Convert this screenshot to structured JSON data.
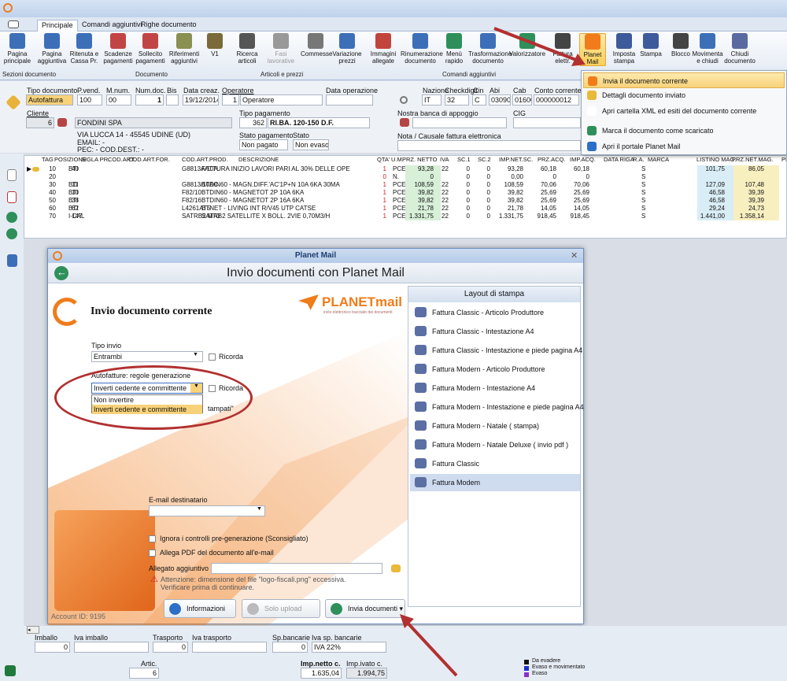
{
  "ribbon": {
    "tabs": [
      "Principale",
      "Comandi aggiuntivi",
      "Righe documento"
    ],
    "buttons": [
      {
        "name": "pagina-principale",
        "label": "Pagina\nprincipale"
      },
      {
        "name": "pagina-aggiuntiva",
        "label": "Pagina\naggiuntiva"
      },
      {
        "name": "ritenuta-cassa",
        "label": "Ritenuta e\nCassa Pr."
      },
      {
        "name": "scadenze-pagamenti",
        "label": "Scadenze\npagamenti"
      },
      {
        "name": "sollecito-pagamenti",
        "label": "Sollecito\npagamenti"
      },
      {
        "name": "riferimenti-aggiuntivi",
        "label": "Riferimenti\naggiuntivi"
      },
      {
        "name": "v1",
        "label": "V1"
      },
      {
        "name": "ricerca-articoli",
        "label": "Ricerca\narticoli"
      },
      {
        "name": "fasi-lavorative",
        "label": "Fasi\nlavorative"
      },
      {
        "name": "commesse",
        "label": "Commesse"
      },
      {
        "name": "variazione-prezzi",
        "label": "Variazione\nprezzi"
      },
      {
        "name": "immagini-allegate",
        "label": "Immagini\nallegate"
      },
      {
        "name": "rinumerazione-documento",
        "label": "Rinumerazione\ndocumento"
      },
      {
        "name": "menu-rapido",
        "label": "Menù\nrapido"
      },
      {
        "name": "trasformazione-documento",
        "label": "Trasformazione\ndocumento"
      },
      {
        "name": "valorizzatore",
        "label": "Valorizzatore"
      },
      {
        "name": "fattura-elettr",
        "label": "Fattura\nelettr."
      },
      {
        "name": "planet-mail",
        "label": "Planet\nMail"
      },
      {
        "name": "imposta-stampa",
        "label": "Imposta\nstampa"
      },
      {
        "name": "stampa",
        "label": "Stampa"
      },
      {
        "name": "blocco",
        "label": "Blocco"
      },
      {
        "name": "movimenta-chiudi",
        "label": "Movimenta\ne chiudi"
      },
      {
        "name": "chiudi-documento",
        "label": "Chiudi\ndocumento"
      }
    ],
    "groups": [
      "Sezioni documento",
      "Documento",
      "Articoli e prezzi",
      "Comandi aggiuntivi"
    ]
  },
  "form": {
    "tipo_documento_label": "Tipo documento",
    "tipo_documento": "Autofattura",
    "p_vend_label": "P.vend.",
    "p_vend": "100",
    "m_num_label": "M.num.",
    "m_num": "00",
    "num_doc_label": "Num.doc.",
    "num_doc": "1",
    "bis_label": "Bis",
    "data_creaz_label": "Data creaz.",
    "data_creaz": "19/12/2014",
    "operatore_label": "Operatore",
    "operatore_num": "1",
    "operatore": "Operatore",
    "data_operazione_label": "Data operazione",
    "cliente_label": "Cliente",
    "cliente_num": "6",
    "cliente": "FONDINI SPA",
    "indirizzo": "VIA LUCCA 14 - 45545 UDINE (UD)",
    "email": "EMAIL: -",
    "pec": "PEC: - COD.DEST.: -",
    "tipo_pagamento_label": "Tipo pagamento",
    "tipo_pagamento_num": "362",
    "tipo_pagamento": "RI.BA. 120-150 D.F.",
    "stato_pagamento_label": "Stato pagamento",
    "stato_pagamento": "Non pagato",
    "stato_label": "Stato",
    "stato": "Non evaso",
    "nazione_label": "Nazione",
    "nazione": "IT",
    "checkdigit_label": "Checkdigit",
    "checkdigit": "32",
    "cin_label": "Cin",
    "cin": "C",
    "abi_label": "Abi",
    "abi": "03090",
    "cab_label": "Cab",
    "cab": "01600",
    "conto_label": "Conto corrente",
    "conto": "000000012",
    "banca_label": "Nostra banca di appoggio",
    "cig_label": "CIG",
    "nota_label": "Nota / Causale fattura elettronica"
  },
  "grid": {
    "headers": [
      "TAG",
      "POSIZIONE",
      "SIGLA PR.",
      "COD.ART.",
      "COD.ART.FOR.",
      "COD.ART.PROD.",
      "DESCRIZIONE",
      "QTA'",
      "U.M.",
      "PRZ. NETTO",
      "IVA",
      "SC.1",
      "SC.2",
      "IMP.NET.SC.",
      "PRZ.ACQ.",
      "IMP.ACQ.",
      "DATA RIGA",
      "R.A.",
      "MARCA",
      "LISTINO MAG.",
      "PRZ.NET.MAG.",
      "PRZ"
    ],
    "rows": [
      [
        "10",
        "BTI",
        "40",
        "",
        "G8813A/10A",
        "FATTURA INIZIO LAVORI PARI AL 30% DELLE OPE",
        "1",
        "PCE",
        "93,28",
        "22",
        "0",
        "0",
        "93,28",
        "60,18",
        "60,18",
        "S",
        "101,75",
        "86,05"
      ],
      [
        "20",
        "",
        "",
        "",
        "",
        "",
        "0",
        "N.",
        "0",
        "",
        "0",
        "0",
        "0,00",
        "0",
        "0",
        "S",
        "",
        ""
      ],
      [
        "30",
        "BTI",
        "11",
        "",
        "G8813/10AC",
        "BTDIN60 - MAGN.DIFF.'AC'1P+N 10A 6KA 30MA",
        "1",
        "PCE",
        "108,59",
        "22",
        "0",
        "0",
        "108,59",
        "70,06",
        "70,06",
        "S",
        "127,09",
        "107,48"
      ],
      [
        "40",
        "BTI",
        "10",
        "",
        "F82/10",
        "BTDIN60 - MAGNETOT 2P 10A 6KA",
        "1",
        "PCE",
        "39,82",
        "22",
        "0",
        "0",
        "39,82",
        "25,69",
        "25,69",
        "S",
        "46,58",
        "39,39"
      ],
      [
        "50",
        "BTI",
        "38",
        "",
        "F82/16",
        "BTDIN60 - MAGNETOT 2P 16A 6KA",
        "1",
        "PCE",
        "39,82",
        "22",
        "0",
        "0",
        "39,82",
        "25,69",
        "25,69",
        "S",
        "46,58",
        "39,39"
      ],
      [
        "60",
        "BTI",
        "62",
        "",
        "L4261AT5",
        "BTNET - LIVING INT R/V45 UTP CATSE",
        "1",
        "PCE",
        "21,78",
        "22",
        "0",
        "0",
        "21,78",
        "14,05",
        "14,05",
        "S",
        "29,24",
        "24,73"
      ],
      [
        "70",
        "I-CAL",
        "147",
        "",
        "SATRB2 M70",
        "SATRB2 SATELLITE X BOLL. 2VIE 0,70M3/H",
        "1",
        "PCE",
        "1.331,75",
        "22",
        "0",
        "0",
        "1.331,75",
        "918,45",
        "918,45",
        "S",
        "1.441,00",
        "1.358,14"
      ]
    ]
  },
  "menu": {
    "items": [
      "Invia il documento corrente",
      "Dettagli documento inviato",
      "Apri cartella XML ed esiti del documento corrente",
      "Marca il documento come scaricato",
      "Apri il portale Planet Mail"
    ]
  },
  "dialog": {
    "title": "Planet Mail",
    "header": "Invio documenti con Planet Mail",
    "section_title": "Invio documento corrente",
    "logo_text": "PLANETmail",
    "logo_tagline": "invio elettronico tracciato dei documenti",
    "tipo_invio_label": "Tipo invio",
    "tipo_invio": "Entrambi",
    "ricorda_label": "Ricorda",
    "autofatture_label": "Autofatture: regole generazione",
    "autofatture_value": "Inverti cedente e committente",
    "dropdown_options": [
      "Non invertire",
      "Inverti cedente e committente"
    ],
    "hidden_text_fragment": "tampati\"",
    "email_label": "E-mail destinatario",
    "ignora_label": "Ignora i controlli pre-generazione (Sconsigliato)",
    "allega_label": "Allega PDF del documento all'e-mail",
    "allegato_label": "Allegato aggiuntivo",
    "warning_line1": "Attenzione: dimensione del file \"logo-fiscali.png\" eccessiva.",
    "warning_line2": "Verificare prima di continuare.",
    "account": "Account ID: 9195",
    "btn_info": "Informazioni",
    "btn_upload": "Solo upload",
    "btn_invia": "Invia documenti",
    "layout_title": "Layout di stampa",
    "layouts": [
      "Fattura Classic - Articolo Produttore",
      "Fattura Classic - Intestazione A4",
      "Fattura Classic - Intestazione e piede pagina A4",
      "Fattura Modern - Articolo Produttore",
      "Fattura Modern - Intestazione A4",
      "Fattura Modern - Intestazione e piede pagina A4",
      "Fattura Modern - Natale ( stampa)",
      "Fattura Modern - Natale Deluxe ( invio pdf )",
      "Fattura Classic",
      "Fattura Modem"
    ]
  },
  "footer": {
    "imballo_label": "Imballo",
    "imballo": "0",
    "iva_imballo_label": "Iva imballo",
    "trasporto_label": "Trasporto",
    "trasporto": "0",
    "iva_trasporto_label": "Iva trasporto",
    "spbancarie_label": "Sp.bancarie",
    "spbancarie": "0",
    "iva_spbancarie_label": "Iva sp. bancarie",
    "iva_spbancarie": "IVA 22%",
    "artic_label": "Artic.",
    "artic": "6",
    "imp_netto_label": "Imp.netto c.",
    "imp_netto": "1.635,04",
    "imp_ivato_label": "Imp.ivato c.",
    "imp_ivato": "1.994,75",
    "legend": [
      "Da evadere",
      "Evaso e movimentato",
      "Evaso"
    ]
  },
  "colors": {
    "accent": "#f07c1b",
    "selection": "#f8d27a",
    "arrow": "#b23030",
    "circle": "#b23030"
  }
}
